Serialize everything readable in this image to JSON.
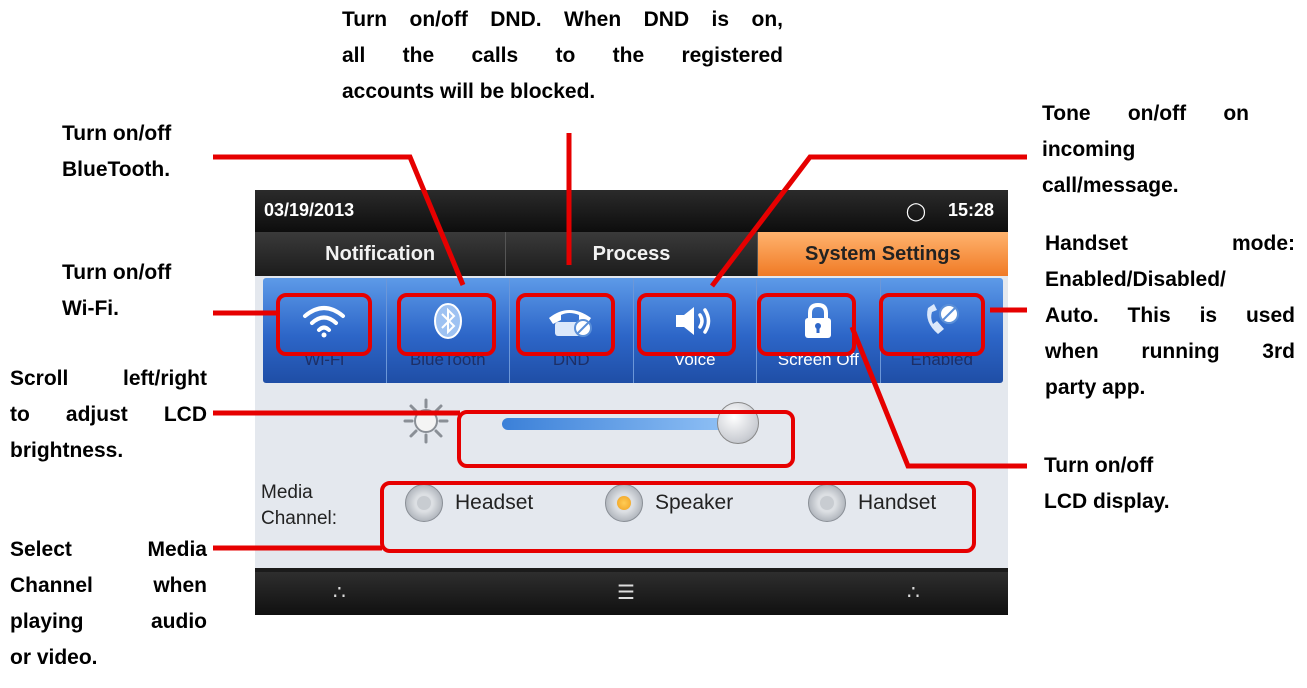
{
  "callouts": {
    "dnd": [
      "Turn on/off DND. When DND is on,",
      "all the calls to the registered",
      "accounts will be blocked."
    ],
    "bluetooth": [
      "Turn on/off",
      "BlueTooth."
    ],
    "wifi": [
      "Turn on/off",
      "Wi-Fi."
    ],
    "brightness": [
      "Scroll left/right",
      "to adjust LCD",
      "brightness."
    ],
    "media": [
      "Select Media",
      "Channel when",
      "playing audio",
      "or video."
    ],
    "tone": [
      "Tone on/off on",
      "incoming",
      "call/message."
    ],
    "handset": [
      "Handset mode:",
      "Enabled/Disabled/",
      "Auto. This is used",
      "when running 3rd",
      "party app."
    ],
    "lcd": [
      "Turn on/off",
      "LCD display."
    ]
  },
  "status": {
    "date": "03/19/2013",
    "time": "15:28"
  },
  "tabs": [
    "Notification",
    "Process",
    "System Settings"
  ],
  "active_tab": "System Settings",
  "quick_settings": [
    {
      "label": "Wi-Fi",
      "icon": "wifi-icon",
      "on": false
    },
    {
      "label": "BlueTooth",
      "icon": "bluetooth-icon",
      "on": false
    },
    {
      "label": "DND",
      "icon": "phone-dnd-icon",
      "on": false
    },
    {
      "label": "Voice",
      "icon": "speaker-icon",
      "on": true
    },
    {
      "label": "Screen Off",
      "icon": "lock-icon",
      "on": true
    },
    {
      "label": "Enabled",
      "icon": "handset-mode-icon",
      "on": false
    }
  ],
  "brightness_level": 0.9,
  "media": {
    "label_line1": "Media",
    "label_line2": "Channel:",
    "options": [
      "Headset",
      "Speaker",
      "Handset"
    ],
    "selected": "Speaker"
  },
  "colors": {
    "annotation": "#e60000",
    "active_tab": "#f07a25",
    "quickbar": "#2d66c8"
  }
}
